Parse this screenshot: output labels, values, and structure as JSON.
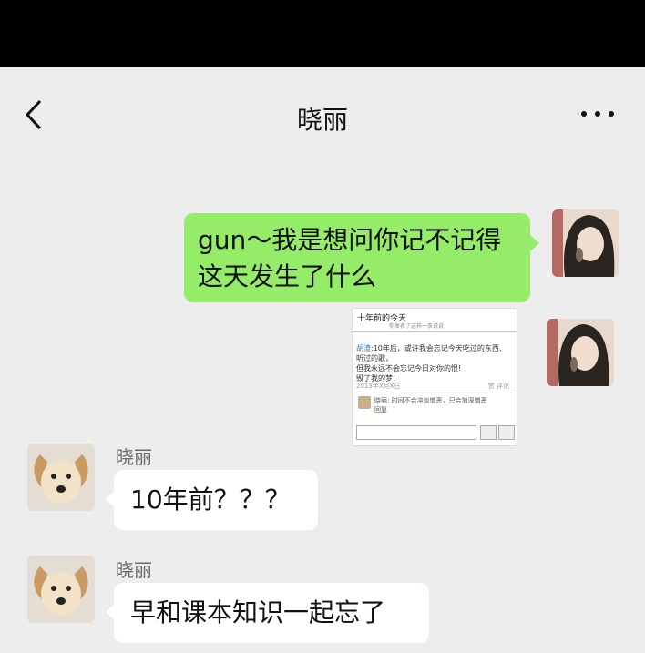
{
  "header": {
    "title": "晓丽"
  },
  "messages": [
    {
      "from": "me",
      "text_line1": "gun～我是想问你记不记得",
      "text_line2": "这天发生了什么"
    },
    {
      "from": "me",
      "type": "image"
    },
    {
      "from": "other",
      "sender": "晓丽",
      "text": "10年前？？？"
    },
    {
      "from": "other",
      "sender": "晓丽",
      "text": "早和课本知识一起忘了"
    }
  ],
  "screenshot": {
    "title": "十年前的今天",
    "subtitle": "你发表了这样一条说说",
    "author": "胡渣",
    "post_line1": ":10年后，或许我会忘记今天吃过的东西、",
    "post_line2": "听过的歌，",
    "post_line3": "但我永远不会忘记今日对你的恨!",
    "post_line4": "毁了我的梦!",
    "date": "2013年X月X日",
    "actions": "赞  评论",
    "reply": "晓丽: 时间不会冲淡憎恶，只会加深憎恶",
    "reply_action": "回复"
  },
  "colors": {
    "me_bubble": "#95ec69",
    "other_bubble": "#ffffff",
    "background": "#ededed"
  },
  "icons": [
    "back-arrow-icon",
    "more-dots-icon"
  ]
}
